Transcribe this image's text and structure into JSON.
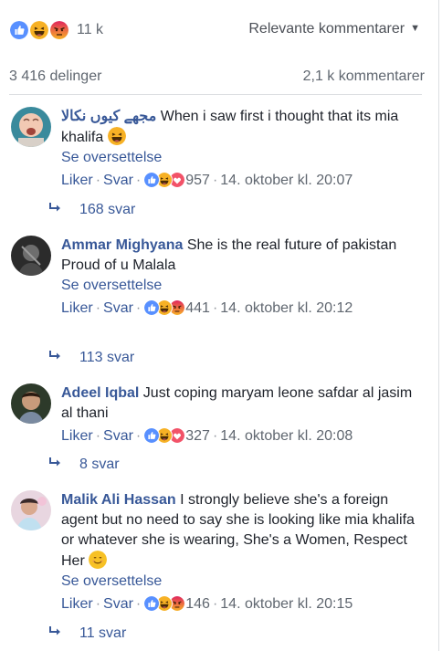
{
  "colors": {
    "like_blue": "#5890ff",
    "haha_yellow": "#f7b125",
    "angry_red": "#e9710f",
    "link": "#385898",
    "meta": "#606770"
  },
  "reaction_summary": {
    "icons": [
      "like-icon",
      "haha-icon",
      "angry-icon"
    ],
    "count": "11 k",
    "sort_label": "Relevante kommentarer"
  },
  "stats": {
    "shares": "3 416 delinger",
    "comments": "2,1 k kommentarer"
  },
  "comments": [
    {
      "author": "مجھے کیوں نکالا",
      "text": " When i saw first i thought that its mia khalifa",
      "translate": "Se oversettelse",
      "like": "Liker",
      "reply": "Svar",
      "reaction_icons": [
        "like-icon",
        "haha-icon",
        "love-icon"
      ],
      "reaction_count": "957",
      "time": "14. oktober kl. 20:07",
      "replies": "168 svar"
    },
    {
      "author": "Ammar Mighyana",
      "text": " She is the real future of pakistan\nProud of u Malala",
      "text_line1": " She is the real future of pakistan",
      "text_line2": "Proud of u Malala",
      "translate": "Se oversettelse",
      "like": "Liker",
      "reply": "Svar",
      "reaction_icons": [
        "like-icon",
        "haha-icon",
        "angry-icon"
      ],
      "reaction_count": "441",
      "time": "14. oktober kl. 20:12",
      "replies": "113 svar"
    },
    {
      "author": "Adeel Iqbal",
      "text": " Just coping maryam leone safdar al jasim al thani",
      "like": "Liker",
      "reply": "Svar",
      "reaction_icons": [
        "like-icon",
        "haha-icon",
        "love-icon"
      ],
      "reaction_count": "327",
      "time": "14. oktober kl. 20:08",
      "replies": "8 svar"
    },
    {
      "author": "Malik Ali Hassan",
      "text": " I strongly believe she's a foreign agent but no need to say she is looking like mia khalifa or whatever she is wearing, She's a Women, Respect Her",
      "translate": "Se oversettelse",
      "like": "Liker",
      "reply": "Svar",
      "reaction_icons": [
        "like-icon",
        "haha-icon",
        "angry-icon"
      ],
      "reaction_count": "146",
      "time": "14. oktober kl. 20:15",
      "replies": "11 svar"
    }
  ],
  "separator": "·"
}
